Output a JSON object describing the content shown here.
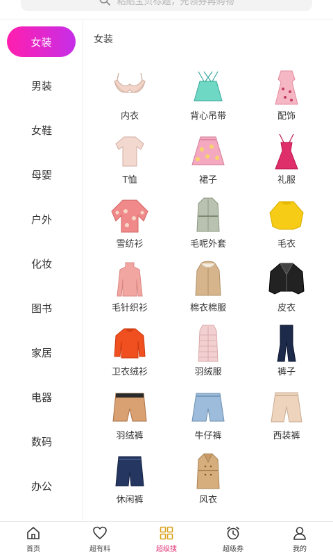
{
  "search": {
    "placeholder": "粘贴宝贝标题，先领券再购物"
  },
  "sidebar": {
    "items": [
      {
        "label": "女装",
        "active": true
      },
      {
        "label": "男装"
      },
      {
        "label": "女鞋"
      },
      {
        "label": "母婴"
      },
      {
        "label": "户外"
      },
      {
        "label": "化妆"
      },
      {
        "label": "图书"
      },
      {
        "label": "家居"
      },
      {
        "label": "电器"
      },
      {
        "label": "数码"
      },
      {
        "label": "办公"
      }
    ]
  },
  "main": {
    "section_title": "女装",
    "items": [
      {
        "label": "内衣",
        "icon": "bra-icon"
      },
      {
        "label": "背心吊带",
        "icon": "camisole-icon"
      },
      {
        "label": "配饰",
        "icon": "dress-icon"
      },
      {
        "label": "T恤",
        "icon": "tshirt-icon"
      },
      {
        "label": "裙子",
        "icon": "skirt-icon"
      },
      {
        "label": "礼服",
        "icon": "gown-icon"
      },
      {
        "label": "雪纺衫",
        "icon": "chiffon-blouse-icon"
      },
      {
        "label": "毛呢外套",
        "icon": "wool-coat-icon"
      },
      {
        "label": "毛衣",
        "icon": "sweater-icon"
      },
      {
        "label": "毛针织衫",
        "icon": "knit-top-icon"
      },
      {
        "label": "棉衣棉服",
        "icon": "padded-coat-icon"
      },
      {
        "label": "皮衣",
        "icon": "leather-jacket-icon"
      },
      {
        "label": "卫衣绒衫",
        "icon": "sweatshirt-icon"
      },
      {
        "label": "羽绒服",
        "icon": "down-jacket-icon"
      },
      {
        "label": "裤子",
        "icon": "flared-pants-icon"
      },
      {
        "label": "羽绒裤",
        "icon": "down-shorts-icon"
      },
      {
        "label": "牛仔裤",
        "icon": "denim-shorts-icon"
      },
      {
        "label": "西装裤",
        "icon": "suit-shorts-icon"
      },
      {
        "label": "休闲裤",
        "icon": "casual-shorts-icon"
      },
      {
        "label": "风衣",
        "icon": "trench-coat-icon"
      }
    ]
  },
  "bottom_nav": {
    "items": [
      {
        "label": "首页",
        "icon": "home-icon"
      },
      {
        "label": "超有料",
        "icon": "heart-icon"
      },
      {
        "label": "超级搜",
        "icon": "grid-icon",
        "active": true
      },
      {
        "label": "超级券",
        "icon": "alarm-clock-icon"
      },
      {
        "label": "我的",
        "icon": "user-icon"
      }
    ]
  },
  "colors": {
    "accent": "#e23b7a",
    "active_gradient_start": "#ff1fae",
    "active_gradient_end": "#c62ee8"
  }
}
